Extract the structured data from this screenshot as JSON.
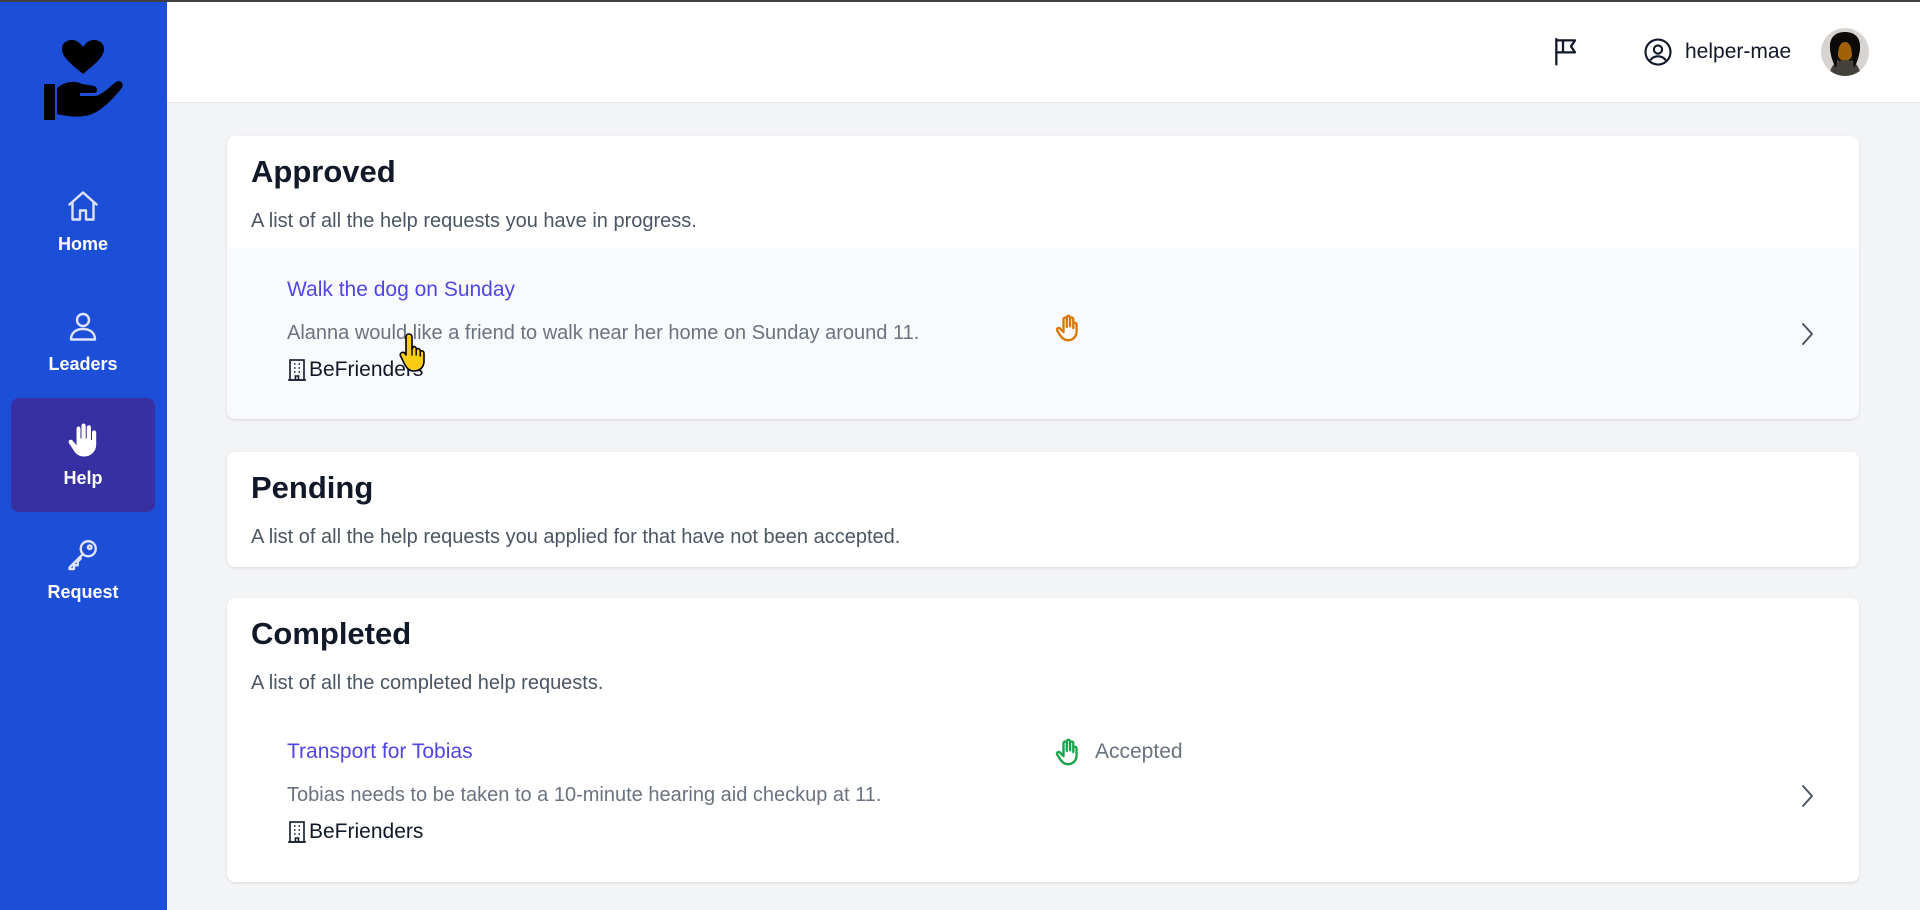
{
  "sidebar": {
    "items": [
      {
        "label": "Home",
        "icon": "home-icon"
      },
      {
        "label": "Leaders",
        "icon": "user-icon"
      },
      {
        "label": "Help",
        "icon": "hand-icon",
        "active": true
      },
      {
        "label": "Request",
        "icon": "key-icon"
      }
    ]
  },
  "header": {
    "username": "helper-mae"
  },
  "sections": {
    "approved": {
      "title": "Approved",
      "subtitle": "A list of all the help requests you have in progress.",
      "requests": [
        {
          "title": "Walk the dog on Sunday",
          "description": "Alanna would like a friend to walk near her home on Sunday around 11.",
          "organization": "BeFrienders",
          "status": ""
        }
      ]
    },
    "pending": {
      "title": "Pending",
      "subtitle": "A list of all the help requests you applied for that have not been accepted."
    },
    "completed": {
      "title": "Completed",
      "subtitle": "A list of all the completed help requests.",
      "requests": [
        {
          "title": "Transport for Tobias",
          "description": "Tobias needs to be taken to a 10-minute hearing aid checkup at 11.",
          "organization": "BeFrienders",
          "status": "Accepted"
        }
      ]
    }
  },
  "colors": {
    "sidebar": "#1d4ed8",
    "sidebar_active": "#3730a3",
    "link": "#4f46e5",
    "status_in_progress": "#d97706",
    "status_accepted": "#16a34a"
  }
}
